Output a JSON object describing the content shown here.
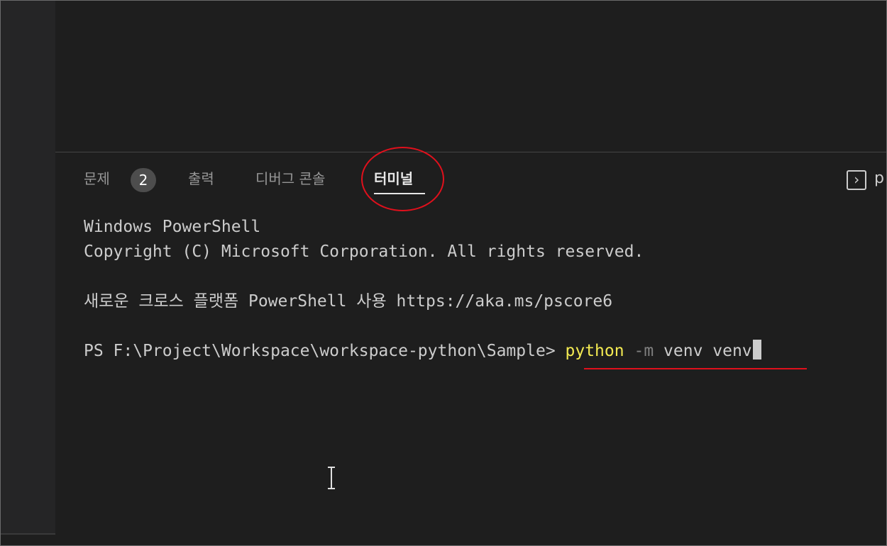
{
  "panel": {
    "tabs": [
      {
        "label": "문제",
        "active": false
      },
      {
        "label": "출력",
        "active": false
      },
      {
        "label": "디버그 콘솔",
        "active": false
      },
      {
        "label": "터미널",
        "active": true
      }
    ],
    "problems_count": "2",
    "terminal_name": "p"
  },
  "terminal": {
    "lines": [
      "Windows PowerShell",
      "Copyright (C) Microsoft Corporation. All rights reserved.",
      "새로운 크로스 플랫폼 PowerShell 사용 https://aka.ms/pscore6"
    ],
    "prompt": "PS F:\\Project\\Workspace\\workspace-python\\Sample> ",
    "command": "python",
    "flag": "-m",
    "args": "venv venv"
  },
  "icons": {
    "terminal_icon": "terminal-prompt-icon",
    "text_cursor": "ibeam-cursor-icon"
  },
  "colors": {
    "background": "#1e1e1e",
    "annotation": "#e0101c",
    "command_yellow": "#f3ea52"
  }
}
